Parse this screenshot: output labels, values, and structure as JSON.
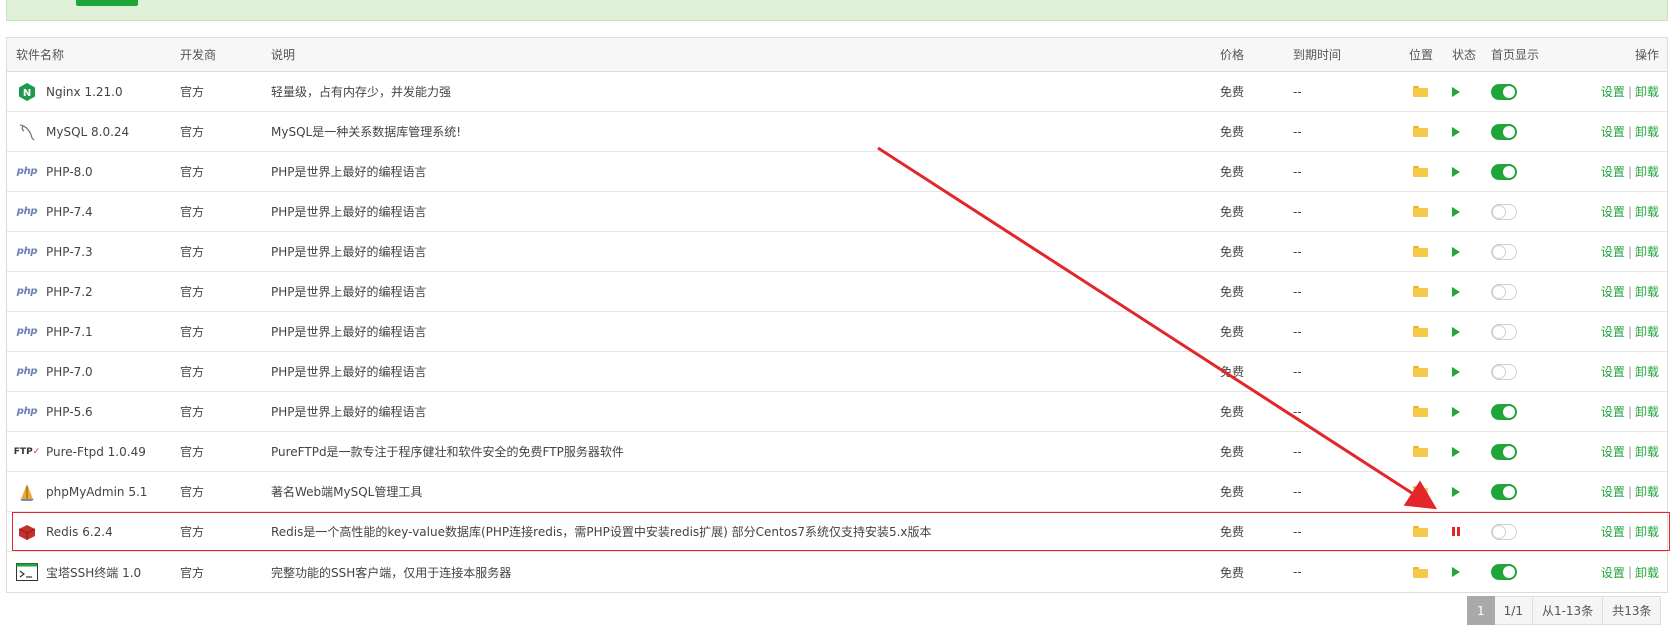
{
  "table": {
    "headers": {
      "name": "软件名称",
      "developer": "开发商",
      "description": "说明",
      "price": "价格",
      "expiry": "到期时间",
      "location": "位置",
      "status": "状态",
      "homepage": "首页显示",
      "actions": "操作"
    },
    "rows": [
      {
        "name": "Nginx 1.21.0",
        "icon": "nginx-icon",
        "developer": "官方",
        "description": "轻量级，占有内存少，并发能力强",
        "price": "免费",
        "expiry": "--",
        "status": "running",
        "homepage": true,
        "settings": "设置",
        "uninstall": "卸载"
      },
      {
        "name": "MySQL 8.0.24",
        "icon": "mysql-icon",
        "developer": "官方",
        "description": "MySQL是一种关系数据库管理系统!",
        "price": "免费",
        "expiry": "--",
        "status": "running",
        "homepage": true,
        "settings": "设置",
        "uninstall": "卸载"
      },
      {
        "name": "PHP-8.0",
        "icon": "php-icon",
        "developer": "官方",
        "description": "PHP是世界上最好的编程语言",
        "price": "免费",
        "expiry": "--",
        "status": "running",
        "homepage": true,
        "settings": "设置",
        "uninstall": "卸载"
      },
      {
        "name": "PHP-7.4",
        "icon": "php-icon",
        "developer": "官方",
        "description": "PHP是世界上最好的编程语言",
        "price": "免费",
        "expiry": "--",
        "status": "running",
        "homepage": false,
        "settings": "设置",
        "uninstall": "卸载"
      },
      {
        "name": "PHP-7.3",
        "icon": "php-icon",
        "developer": "官方",
        "description": "PHP是世界上最好的编程语言",
        "price": "免费",
        "expiry": "--",
        "status": "running",
        "homepage": false,
        "settings": "设置",
        "uninstall": "卸载"
      },
      {
        "name": "PHP-7.2",
        "icon": "php-icon",
        "developer": "官方",
        "description": "PHP是世界上最好的编程语言",
        "price": "免费",
        "expiry": "--",
        "status": "running",
        "homepage": false,
        "settings": "设置",
        "uninstall": "卸载"
      },
      {
        "name": "PHP-7.1",
        "icon": "php-icon",
        "developer": "官方",
        "description": "PHP是世界上最好的编程语言",
        "price": "免费",
        "expiry": "--",
        "status": "running",
        "homepage": false,
        "settings": "设置",
        "uninstall": "卸载"
      },
      {
        "name": "PHP-7.0",
        "icon": "php-icon",
        "developer": "官方",
        "description": "PHP是世界上最好的编程语言",
        "price": "免费",
        "expiry": "--",
        "status": "running",
        "homepage": false,
        "settings": "设置",
        "uninstall": "卸载"
      },
      {
        "name": "PHP-5.6",
        "icon": "php-icon",
        "developer": "官方",
        "description": "PHP是世界上最好的编程语言",
        "price": "免费",
        "expiry": "--",
        "status": "running",
        "homepage": true,
        "settings": "设置",
        "uninstall": "卸载"
      },
      {
        "name": "Pure-Ftpd 1.0.49",
        "icon": "ftp-icon",
        "developer": "官方",
        "description": "PureFTPd是一款专注于程序健壮和软件安全的免费FTP服务器软件",
        "price": "免费",
        "expiry": "--",
        "status": "running",
        "homepage": true,
        "settings": "设置",
        "uninstall": "卸载"
      },
      {
        "name": "phpMyAdmin 5.1",
        "icon": "phpmyadmin-icon",
        "developer": "官方",
        "description": "著名Web端MySQL管理工具",
        "price": "免费",
        "expiry": "--",
        "status": "running",
        "homepage": true,
        "settings": "设置",
        "uninstall": "卸载"
      },
      {
        "name": "Redis 6.2.4",
        "icon": "redis-icon",
        "developer": "官方",
        "description": "Redis是一个高性能的key-value数据库(PHP连接redis，需PHP设置中安装redis扩展) 部分Centos7系统仅支持安装5.x版本",
        "price": "免费",
        "expiry": "--",
        "status": "stopped",
        "homepage": false,
        "settings": "设置",
        "uninstall": "卸载"
      },
      {
        "name": "宝塔SSH终端 1.0",
        "icon": "terminal-icon",
        "developer": "官方",
        "description": "完整功能的SSH客户端，仅用于连接本服务器",
        "price": "免费",
        "expiry": "--",
        "status": "running",
        "homepage": true,
        "settings": "设置",
        "uninstall": "卸载"
      }
    ]
  },
  "pagination": {
    "current": "1",
    "pages": "1/1",
    "range": "从1-13条",
    "total": "共13条"
  },
  "colors": {
    "accent": "#20a53a",
    "highlight": "#e3262a",
    "banner": "#dff0d8"
  }
}
